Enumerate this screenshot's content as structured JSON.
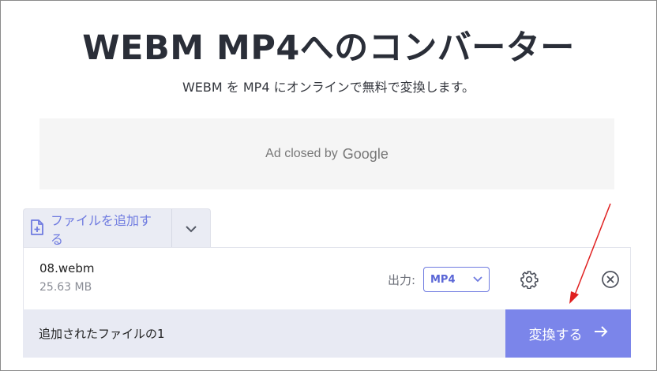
{
  "header": {
    "title": "WEBM MP4へのコンバーター",
    "subtitle": "WEBM を MP4 にオンラインで無料で変換します。"
  },
  "ad": {
    "text": "Ad closed by",
    "brand": "Google"
  },
  "uploader": {
    "add_label": "ファイルを追加する",
    "add_icon": "file-plus-icon",
    "dropdown_icon": "chevron-down-icon"
  },
  "file": {
    "name": "08.webm",
    "size": "25.63 MB",
    "output_label": "出力:",
    "output_format": "MP4",
    "settings_icon": "gear-icon",
    "remove_icon": "close-circle-icon"
  },
  "footer": {
    "count_text": "追加されたファイルの1",
    "convert_label": "変換する",
    "convert_icon": "arrow-right-icon"
  },
  "colors": {
    "accent": "#7b85ea",
    "accent_text": "#6f7be0",
    "annotation_arrow": "#e02020"
  }
}
